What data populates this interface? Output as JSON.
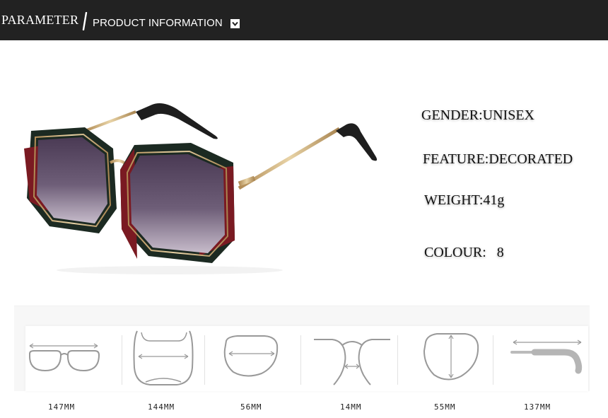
{
  "header": {
    "parameter_label": "PARAMETER",
    "section_label": "PRODUCT INFORMATION",
    "dropdown_icon": "chevron-down-icon"
  },
  "specs": {
    "gender": "GENDER:UNISEX",
    "feature": "FEATURE:DECORATED",
    "weight": "WEIGHT:41g",
    "colour": "COLOUR:   8"
  },
  "measurements": [
    {
      "value": "147MM",
      "icon": "frame-width-icon"
    },
    {
      "value": "144MM",
      "icon": "temple-width-icon"
    },
    {
      "value": "56MM",
      "icon": "lens-width-icon"
    },
    {
      "value": "14MM",
      "icon": "bridge-width-icon"
    },
    {
      "value": "55MM",
      "icon": "lens-height-icon"
    },
    {
      "value": "137MM",
      "icon": "temple-length-icon"
    }
  ],
  "colors": {
    "topbar": "#222222",
    "frame_green": "#1c2a22",
    "frame_red": "#7a1a22",
    "metal_gold": "#c8a874",
    "lens": "#5a4a63",
    "diagram_gray": "#9a9a9a"
  }
}
